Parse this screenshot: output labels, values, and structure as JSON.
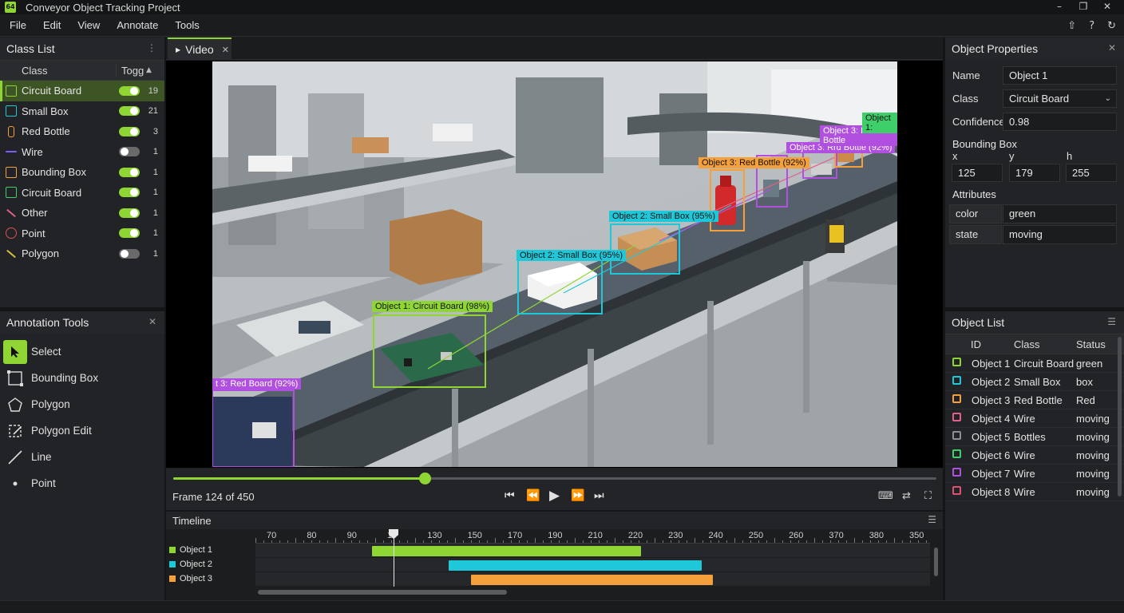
{
  "app": {
    "title": "Conveyor Object Tracking Project",
    "icon_text": "64"
  },
  "window_controls": [
    "minimize-icon",
    "restore-icon",
    "close-icon"
  ],
  "menu": {
    "items": [
      "File",
      "Edit",
      "View",
      "Annotate",
      "Tools"
    ]
  },
  "class_list": {
    "title": "Class List",
    "col_class": "Class",
    "col_toggle": "Togg",
    "items": [
      {
        "label": "Circuit Board",
        "count": "19",
        "on": true,
        "color": "#8fd635",
        "icon": "circuit-board-icon",
        "selected": true
      },
      {
        "label": "Small Box",
        "count": "21",
        "on": true,
        "color": "#1fc8d8",
        "icon": "cube-icon"
      },
      {
        "label": "Red Bottle",
        "count": "3",
        "on": true,
        "color": "#f5a03a",
        "icon": "bottle-icon"
      },
      {
        "label": "Wire",
        "count": "1",
        "on": false,
        "color": "#7c5cff",
        "icon": "wire-icon"
      },
      {
        "label": "Bounding Box",
        "count": "1",
        "on": true,
        "color": "#f5a03a",
        "icon": "bounding-box-icon"
      },
      {
        "label": "Circuit Board",
        "count": "1",
        "on": true,
        "color": "#3ecf6a",
        "icon": "circuit-board-icon"
      },
      {
        "label": "Other",
        "count": "1",
        "on": true,
        "color": "#e0608a",
        "icon": "other-icon"
      },
      {
        "label": "Point",
        "count": "1",
        "on": true,
        "color": "#e05050",
        "icon": "point-icon"
      },
      {
        "label": "Polygon",
        "count": "1",
        "on": false,
        "color": "#d8c040",
        "icon": "polygon-icon"
      }
    ]
  },
  "annotation_tools": {
    "title": "Annotation Tools",
    "items": [
      {
        "label": "Select",
        "icon": "cursor-icon",
        "active": true
      },
      {
        "label": "Bounding Box",
        "icon": "bounding-box-icon"
      },
      {
        "label": "Polygon",
        "icon": "polygon-icon"
      },
      {
        "label": "Polygon Edit",
        "icon": "polygon-edit-icon"
      },
      {
        "label": "Line",
        "icon": "line-icon"
      },
      {
        "label": "Point",
        "icon": "point-icon"
      }
    ]
  },
  "video": {
    "tab_label": "Video",
    "overlay_labels": [
      {
        "text": "Object 1: Circuit Board (98%)",
        "color": "#8fd635"
      },
      {
        "text": "Object 2: Small Box (95%)",
        "color": "#1fc8d8"
      },
      {
        "text": "Object 2: Small Box (95%)",
        "color": "#1fc8d8"
      },
      {
        "text": "Object 3: Red Bottle (92%)",
        "color": "#f5a03a"
      },
      {
        "text": "Object 3: Rrd Bottle (92%)",
        "color": "#b04fe0"
      },
      {
        "text": "Object 3: Red Bottle",
        "color": "#b04fe0"
      },
      {
        "text": "Object 1:",
        "color": "#3ecf6a"
      },
      {
        "text": "t 3: Red Board (92%)",
        "color": "#b04fe0"
      }
    ]
  },
  "player": {
    "frame_text": "Frame 124 of 450",
    "progress": 0.33,
    "controls": [
      "skip-start-icon",
      "rewind-icon",
      "play-icon",
      "fast-forward-icon",
      "skip-end-icon"
    ],
    "right_controls": [
      "keyboard-icon",
      "export-icon",
      "fullscreen-icon"
    ]
  },
  "timeline": {
    "title": "Timeline",
    "ticks": [
      "70",
      "80",
      "90",
      "10",
      "130",
      "150",
      "170",
      "190",
      "210",
      "220",
      "230",
      "240",
      "250",
      "260",
      "370",
      "380",
      "350"
    ],
    "tracks": [
      {
        "label": "Object 1",
        "color": "#8fd635",
        "start": 0.173,
        "end": 0.572
      },
      {
        "label": "Object 2",
        "color": "#1fc8d8",
        "start": 0.286,
        "end": 0.661
      },
      {
        "label": "Object 3",
        "color": "#f5a03a",
        "start": 0.319,
        "end": 0.678
      }
    ]
  },
  "properties": {
    "title": "Object Properties",
    "name_label": "Name",
    "name_value": "Object 1",
    "class_label": "Class",
    "class_value": "Circuit Board",
    "confidence_label": "Confidence",
    "confidence_value": "0.98",
    "bbox_label": "Bounding Box",
    "bbox": {
      "x_label": "x",
      "x": "125",
      "y_label": "y",
      "y": "179",
      "h_label": "h",
      "h": "255"
    },
    "attributes_label": "Attributes",
    "attributes": [
      {
        "key": "color",
        "value": "green"
      },
      {
        "key": "state",
        "value": "moving"
      }
    ]
  },
  "object_list": {
    "title": "Object List",
    "col_id": "ID",
    "col_class": "Class",
    "col_status": "Status",
    "rows": [
      {
        "id": "Object 1",
        "cls": "Circuit Board",
        "status": "green",
        "color": "#8fd635"
      },
      {
        "id": "Object 2",
        "cls": "Small Box",
        "status": "box",
        "color": "#1fc8d8"
      },
      {
        "id": "Object 3",
        "cls": "Red Bottle",
        "status": "Red",
        "color": "#f5a03a"
      },
      {
        "id": "Object 4",
        "cls": "Wire",
        "status": "moving",
        "color": "#e0608a"
      },
      {
        "id": "Object 5",
        "cls": "Bottles",
        "status": "moving",
        "color": "#8a8f94"
      },
      {
        "id": "Object 6",
        "cls": "Wire",
        "status": "moving",
        "color": "#3ecf6a"
      },
      {
        "id": "Object 7",
        "cls": "Wire",
        "status": "moving",
        "color": "#b04fe0"
      },
      {
        "id": "Object 8",
        "cls": "Wire",
        "status": "moving",
        "color": "#e05070"
      }
    ]
  }
}
